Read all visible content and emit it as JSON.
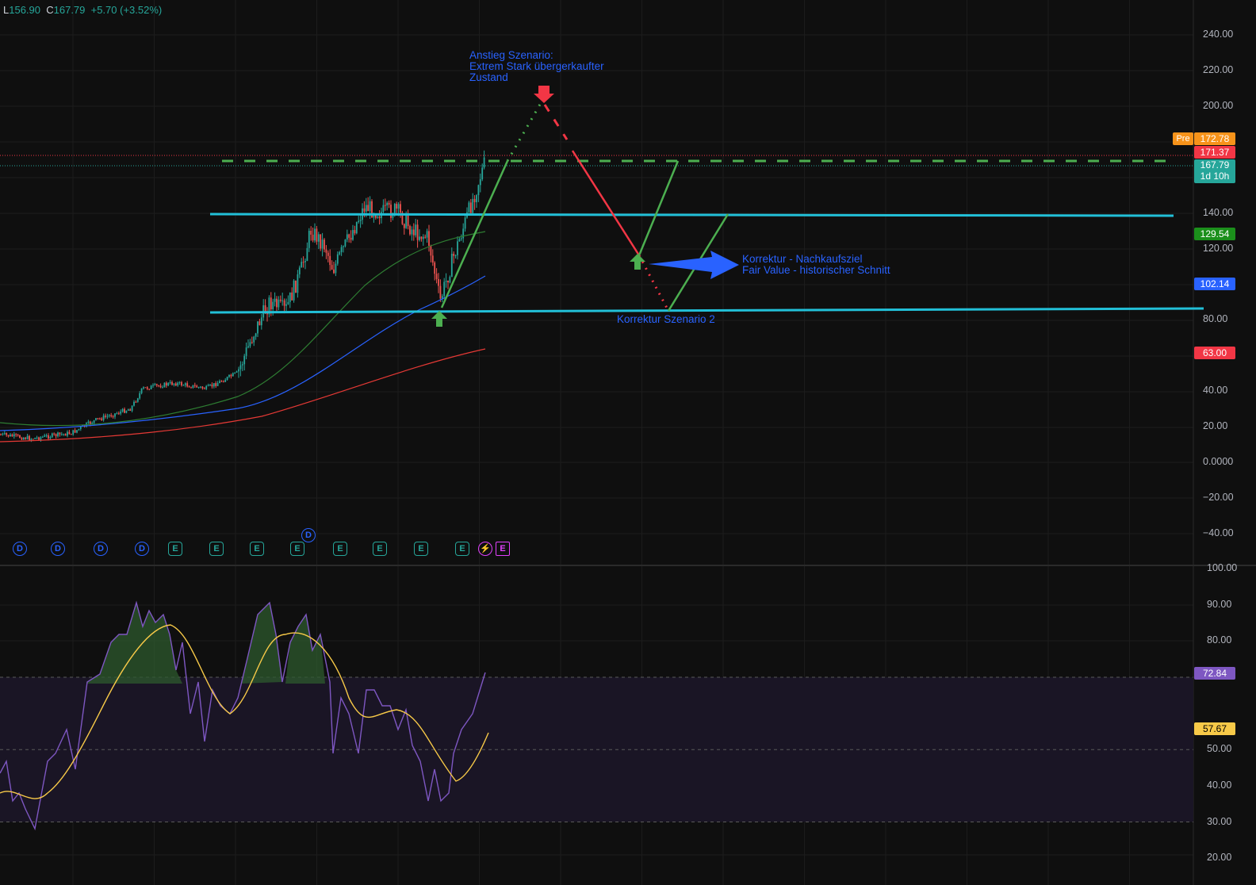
{
  "legend": {
    "low_key": "L",
    "low": "156.90",
    "close_key": "C",
    "close": "167.79",
    "change": "+5.70 (+3.52%)"
  },
  "price_axis": {
    "ticks": [
      "240.00",
      "220.00",
      "200.00",
      "140.00",
      "120.00",
      "80.00",
      "40.00",
      "20.00",
      "0.0000",
      "−20.00",
      "−40.00"
    ]
  },
  "badges": {
    "pre_tag": "Pre",
    "pre_price": "172.78",
    "high_price": "171.37",
    "last_price": "167.79",
    "countdown": "1d 10h",
    "level_129": "129.54",
    "level_102": "102.14",
    "level_63": "63.00",
    "rsi_value": "72.84",
    "rsi_ma_value": "57.67"
  },
  "rsi_axis": {
    "ticks": [
      "100.00",
      "90.00",
      "80.00",
      "50.00",
      "40.00",
      "30.00",
      "20.00"
    ]
  },
  "annotations": {
    "up_scenario": "Anstieg Szenario:\nExtrem Stark übergerkaufter\nZustand",
    "correction_target": "Korrektur - Nachkaufsziel\nFair Value - historischer Schnitt",
    "correction_2": "Korrektur Szenario 2"
  },
  "events": [
    {
      "type": "D",
      "label": "D"
    },
    {
      "type": "D",
      "label": "D"
    },
    {
      "type": "D",
      "label": "D"
    },
    {
      "type": "D",
      "label": "D"
    },
    {
      "type": "E",
      "label": "E"
    },
    {
      "type": "E",
      "label": "E"
    },
    {
      "type": "E",
      "label": "E"
    },
    {
      "type": "E",
      "label": "E"
    },
    {
      "type": "E",
      "label": "E"
    },
    {
      "type": "E",
      "label": "E"
    },
    {
      "type": "E",
      "label": "E"
    },
    {
      "type": "E",
      "label": "E"
    },
    {
      "type": "S",
      "label": "⚡"
    },
    {
      "type": "M",
      "label": "E"
    }
  ],
  "dividend_marker": "D",
  "colors": {
    "up": "#26a69a",
    "down": "#ef5350",
    "cyan_line": "#22c0d8",
    "green_tl": "#4caf50",
    "red_path": "#f23645",
    "rsi": "#7e57c2",
    "rsi_ma": "#f7c948",
    "ma_blue": "#2962ff",
    "ma_red": "#e53935",
    "ma_green": "#2e7d32",
    "accent_blue": "#2962ff"
  }
}
